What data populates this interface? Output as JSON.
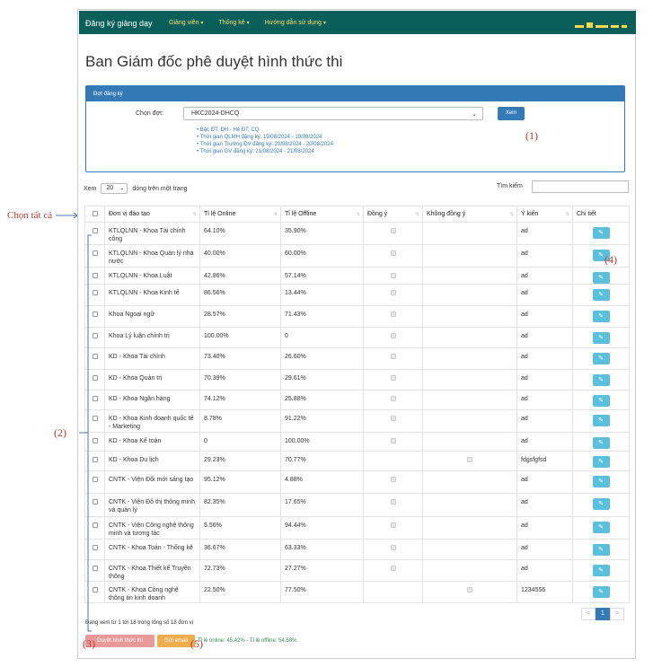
{
  "navbar": {
    "brand": "Đăng ký giảng dạy",
    "menu": [
      "Giảng viên",
      "Thống kê",
      "Hướng dẫn sử dụng"
    ]
  },
  "page_title": "Ban Giám đốc phê duyệt hình thức thi",
  "panel": {
    "title": "Đợt đăng ký",
    "period_label": "Chọn đợt:",
    "period_value": "HKC2024-DHCQ",
    "view_button": "Xem",
    "info": [
      "Bậc ĐT: ĐH - Hệ ĐT: CQ",
      "Thời gian QLMH đăng ký: 15/08/2024 - 19/08/2024",
      "Thời gian Trưởng ĐV đăng ký: 20/08/2024 - 20/08/2024",
      "Thời gian GV đăng ký: 21/08/2024 - 21/08/2024"
    ]
  },
  "table_controls": {
    "show_label": "Xem",
    "page_size": "20",
    "per_page_label": "dòng trên một trang",
    "search_label": "Tìm kiếm"
  },
  "columns": [
    "Đơn vị đào tạo",
    "Tỉ lệ Online",
    "Tỉ lệ Offline",
    "Đồng ý",
    "Không đồng ý",
    "Ý kiến",
    "Chi tiết"
  ],
  "rows": [
    {
      "unit": "KTLQLNN - Khoa Tài chính công",
      "online": "64.10%",
      "offline": "35.90%",
      "agree": true,
      "disagree": false,
      "opinion": "ad"
    },
    {
      "unit": "KTLQLNN - Khoa Quản lý nhà nước",
      "online": "40.00%",
      "offline": "60.00%",
      "agree": true,
      "disagree": false,
      "opinion": "ad"
    },
    {
      "unit": "KTLQLNN - Khoa Luật",
      "online": "42.86%",
      "offline": "57.14%",
      "agree": true,
      "disagree": false,
      "opinion": "ad"
    },
    {
      "unit": "KTLQLNN - Khoa Kinh tế",
      "online": "86.56%",
      "offline": "13.44%",
      "agree": true,
      "disagree": false,
      "opinion": "ad"
    },
    {
      "unit": "Khoa Ngoại ngữ",
      "online": "28.57%",
      "offline": "71.43%",
      "agree": true,
      "disagree": false,
      "opinion": "ad"
    },
    {
      "unit": "Khoa Lý luận chính trị",
      "online": "100.00%",
      "offline": "0",
      "agree": true,
      "disagree": false,
      "opinion": "ad"
    },
    {
      "unit": "KD - Khoa Tài chính",
      "online": "73.40%",
      "offline": "26.60%",
      "agree": true,
      "disagree": false,
      "opinion": "ad"
    },
    {
      "unit": "KD - Khoa Quản trị",
      "online": "70.39%",
      "offline": "29.61%",
      "agree": true,
      "disagree": false,
      "opinion": "ad"
    },
    {
      "unit": "KD - Khoa Ngân hàng",
      "online": "74.12%",
      "offline": "25.88%",
      "agree": true,
      "disagree": false,
      "opinion": "ad"
    },
    {
      "unit": "KD - Khoa Kinh doanh quốc tế - Marketing",
      "online": "8.78%",
      "offline": "91.22%",
      "agree": true,
      "disagree": false,
      "opinion": "ad"
    },
    {
      "unit": "KD - Khoa Kế toán",
      "online": "0",
      "offline": "100.00%",
      "agree": true,
      "disagree": false,
      "opinion": "ad"
    },
    {
      "unit": "KD - Khoa Du lịch",
      "online": "29.23%",
      "offline": "70.77%",
      "agree": false,
      "disagree": true,
      "opinion": "fdgsfgfsd"
    },
    {
      "unit": "CNTK - Viện Đổi mới sáng tạo",
      "online": "95.12%",
      "offline": "4.88%",
      "agree": true,
      "disagree": false,
      "opinion": "ad"
    },
    {
      "unit": "CNTK - Viện Đô thị thông minh và quản lý",
      "online": "82.35%",
      "offline": "17.65%",
      "agree": true,
      "disagree": false,
      "opinion": "ad"
    },
    {
      "unit": "CNTK - Viện Công nghệ thông minh và tương tác",
      "online": "5.56%",
      "offline": "94.44%",
      "agree": true,
      "disagree": false,
      "opinion": "ad"
    },
    {
      "unit": "CNTK - Khoa Toán - Thống kê",
      "online": "36.67%",
      "offline": "63.33%",
      "agree": true,
      "disagree": false,
      "opinion": "ad"
    },
    {
      "unit": "CNTK - Khoa Thiết kế Truyền thông",
      "online": "72.73%",
      "offline": "27.27%",
      "agree": true,
      "disagree": false,
      "opinion": "ad"
    },
    {
      "unit": "CNTK - Khoa Công nghệ thông tin kinh doanh",
      "online": "22.50%",
      "offline": "77.50%",
      "agree": false,
      "disagree": true,
      "opinion": "1234556"
    }
  ],
  "footer": {
    "showing": "Đang xem từ 1 tới 18 trong tổng số 18 đơn vị",
    "approve_button": "Duyệt hình thức thi",
    "email_button": "Gửi email",
    "rate_summary": "Tỉ lệ online: 45.42% - Tỉ lệ offline: 54.58%",
    "pager": [
      "<",
      "1",
      ">"
    ]
  },
  "annotations": {
    "select_all": "Chọn tất cả",
    "m1": "(1)",
    "m2": "(2)",
    "m3": "(3)",
    "m4": "(4)",
    "m5": "(5)"
  },
  "colors": {
    "navbar": "#0b5f5a",
    "primary": "#337ab7",
    "info": "#5bc0de",
    "danger_light": "#e99a98",
    "warning": "#f0ad4e",
    "annotation": "#c0392b"
  }
}
